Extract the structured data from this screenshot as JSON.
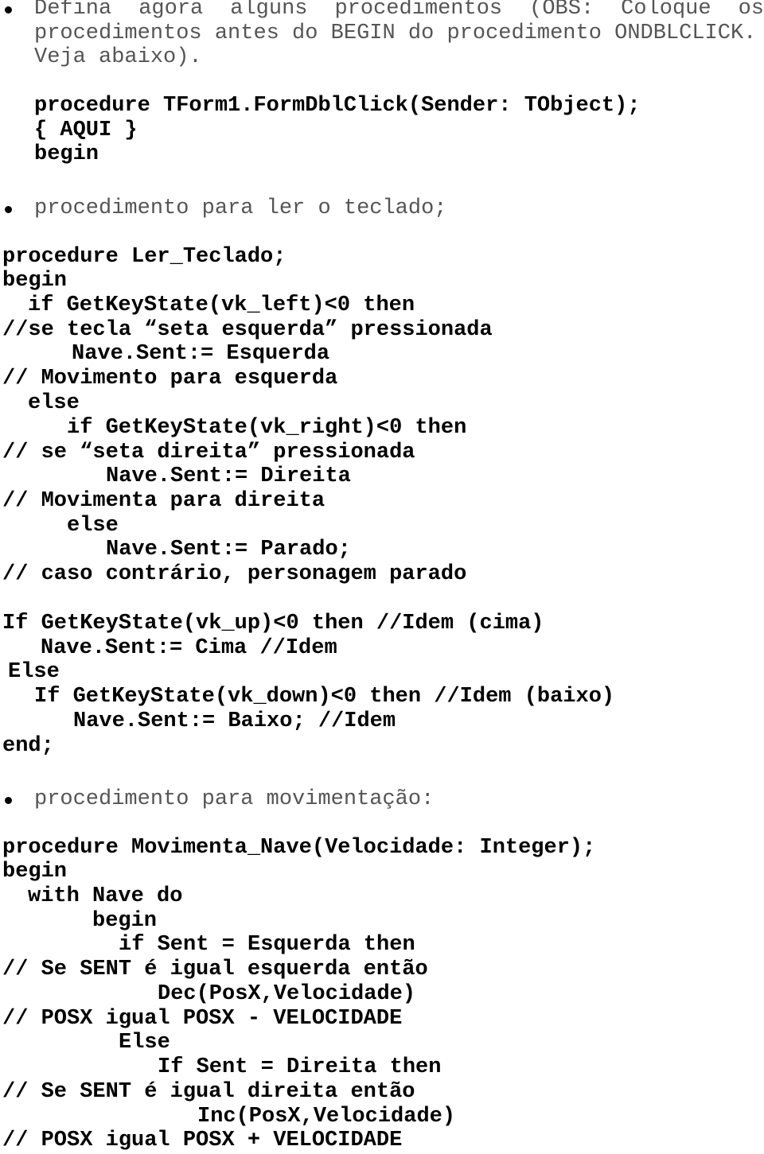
{
  "intro": {
    "bullet_icon": "bullet-icon",
    "lines": [
      "Defina agora alguns procedimentos (OBS: Coloque os",
      "procedimentos antes do BEGIN do procedimento ONDBLCLICK.",
      "Veja abaixo)."
    ]
  },
  "form_proc": {
    "lines": [
      "procedure TForm1.FormDblClick(Sender: TObject);",
      "{ AQUI }",
      "begin"
    ]
  },
  "section_keyboard": {
    "heading": "procedimento para ler o teclado;",
    "code": [
      "procedure Ler_Teclado;",
      "begin",
      "if GetKeyState(vk_left)<0 then",
      "//se tecla “seta esquerda” pressionada",
      "Nave.Sent:= Esquerda",
      "// Movimento para esquerda",
      "else",
      "if GetKeyState(vk_right)<0 then",
      "// se “seta direita” pressionada",
      "Nave.Sent:= Direita",
      "// Movimenta para direita",
      "else",
      "Nave.Sent:= Parado;",
      "// caso contrário, personagem parado",
      "If GetKeyState(vk_up)<0 then //Idem (cima)",
      "Nave.Sent:= Cima //Idem",
      "Else",
      "If GetKeyState(vk_down)<0 then //Idem (baixo)",
      "Nave.Sent:= Baixo; //Idem",
      "end;"
    ]
  },
  "section_movement": {
    "heading": "procedimento para movimentação:",
    "code": [
      "procedure Movimenta_Nave(Velocidade: Integer);",
      "begin",
      "with Nave do",
      "begin",
      "if Sent = Esquerda then",
      "// Se SENT é igual esquerda então",
      "Dec(PosX,Velocidade)",
      "// POSX igual POSX - VELOCIDADE",
      "Else",
      "If Sent = Direita then",
      "// Se SENT é igual direita então",
      "Inc(PosX,Velocidade)",
      "// POSX igual POSX + VELOCIDADE"
    ]
  }
}
